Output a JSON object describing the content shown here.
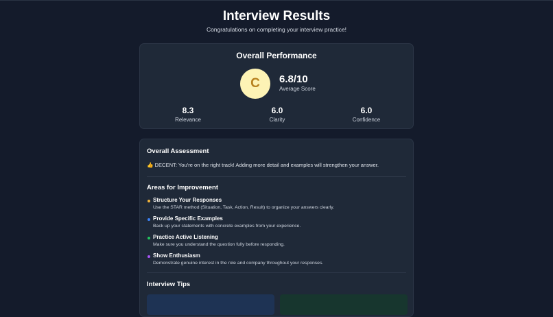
{
  "header": {
    "title": "Interview Results",
    "subtitle": "Congratulations on completing your interview practice!"
  },
  "performance": {
    "title": "Overall Performance",
    "grade": "C",
    "average_score": "6.8/10",
    "average_label": "Average Score",
    "metrics": [
      {
        "value": "8.3",
        "label": "Relevance"
      },
      {
        "value": "6.0",
        "label": "Clarity"
      },
      {
        "value": "6.0",
        "label": "Confidence"
      }
    ]
  },
  "assessment": {
    "title": "Overall Assessment",
    "icon": "thumbs-up-icon",
    "text": "DECENT: You're on the right track! Adding more detail and examples will strengthen your answer."
  },
  "improvement": {
    "title": "Areas for Improvement",
    "items": [
      {
        "title": "Structure Your Responses",
        "desc": "Use the STAR method (Situation, Task, Action, Result) to organize your answers clearly.",
        "color": "#f2b43a"
      },
      {
        "title": "Provide Specific Examples",
        "desc": "Back up your statements with concrete examples from your experience.",
        "color": "#3b82f6"
      },
      {
        "title": "Practice Active Listening",
        "desc": "Make sure you understand the question fully before responding.",
        "color": "#22c55e"
      },
      {
        "title": "Show Enthusiasm",
        "desc": "Demonstrate genuine interest in the role and company throughout your responses.",
        "color": "#a855f7"
      }
    ]
  },
  "tips": {
    "title": "Interview Tips"
  },
  "colors": {
    "background": "#141b2b",
    "card": "#1f2938",
    "grade_bg": "#fdf3b5",
    "grade_text": "#b7811f"
  }
}
